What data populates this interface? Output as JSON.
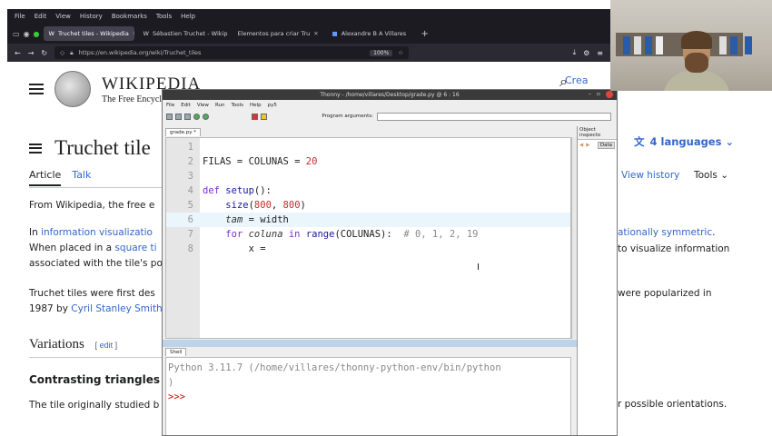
{
  "browser": {
    "menu": [
      "File",
      "Edit",
      "View",
      "History",
      "Bookmarks",
      "Tools",
      "Help"
    ],
    "tabs": [
      {
        "label": "Truchet tiles - Wikipedia",
        "active": true
      },
      {
        "label": "Sébastien Truchet - Wikip",
        "active": false
      },
      {
        "label": "Elementos para criar Tru",
        "active": false
      },
      {
        "label": "Alexandre B A Villares",
        "active": false
      }
    ],
    "url": "https://en.wikipedia.org/wiki/Truchet_tiles",
    "zoom": "100%"
  },
  "wiki": {
    "wordmark": "WIKIPEDIA",
    "tagline": "The Free Encyclopedia",
    "create": "Crea",
    "title": "Truchet tile",
    "tab_article": "Article",
    "tab_talk": "Talk",
    "languages": "4 languages",
    "view_history": "View history",
    "tools": "Tools",
    "from": "From Wikipedia, the free e",
    "p1_start": "In",
    "p1_link1": "information visualizatio",
    "p1_line2_pre": "When placed in a",
    "p1_link2": "square ti",
    "p1_line3": "associated with the tile's po",
    "p1_right_link": "ationally symmetric",
    "p1_right_tail": ".",
    "p1_right2": "to visualize information",
    "p2_line1": "Truchet tiles were first des",
    "p2_line2_pre": "1987 by",
    "p2_link": "Cyril Stanley Smith",
    "p2_right": "were popularized in",
    "h_variations": "Variations",
    "edit": "edit",
    "h_contrasting": "Contrasting triangles",
    "p3": "The tile originally studied b",
    "p3_right": "r possible orientations."
  },
  "thonny": {
    "title": "Thonny - /home/villares/Desktop/grade.py @ 6 : 16",
    "menu": [
      "File",
      "Edit",
      "View",
      "Run",
      "Tools",
      "Help",
      "py5"
    ],
    "program_args": "Program arguments:",
    "editor_tab": "grade.py *",
    "object_inspector": "Object inspecto",
    "data_btn": "Data",
    "shell_tab": "Shell",
    "shell_line1": "Python 3.11.7 (/home/villares/thonny-python-env/bin/python",
    "shell_line2": ")",
    "shell_prompt": ">>>",
    "code": {
      "l1": "",
      "l2_a": "FILAS = COLUNAS = ",
      "l2_n": "20",
      "l3": "",
      "l4_kw": "def",
      "l4_fn": "setup",
      "l4_rest": "():",
      "l5_fn": "size",
      "l5_n1": "800",
      "l5_n2": "800",
      "l6_v": "tam",
      "l6_rest": " = width",
      "l7_kw": "for",
      "l7_v": "coluna",
      "l7_kw2": "in",
      "l7_fn": "range",
      "l7_rest": "(COLUNAS):",
      "l7_cm": "# 0, 1, 2, 19",
      "l8": "x ="
    }
  }
}
